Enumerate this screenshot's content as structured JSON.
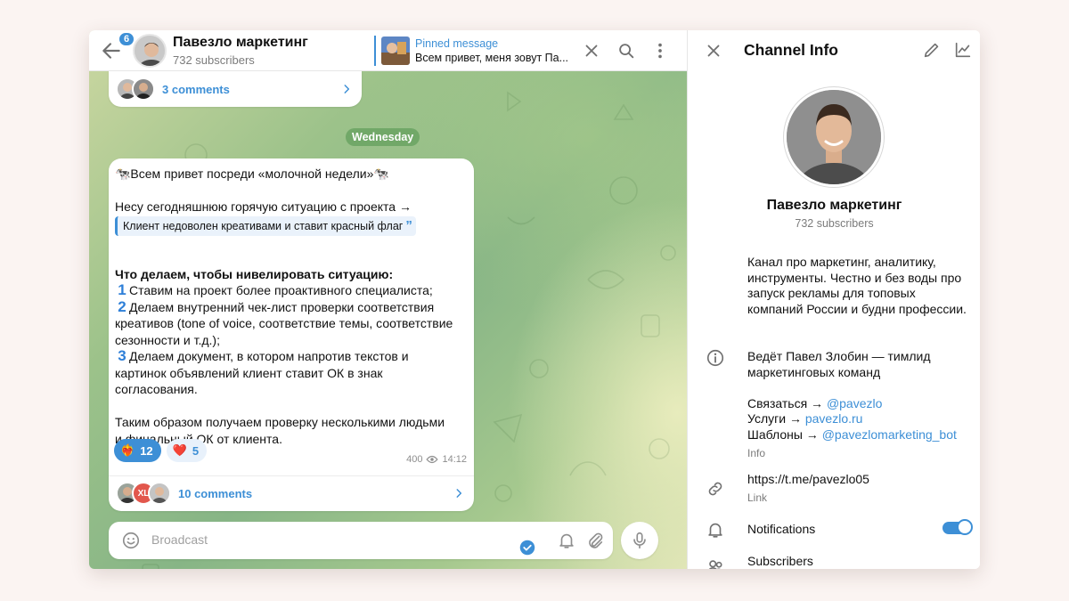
{
  "chat": {
    "unread_count": "6",
    "channel_title": "Павезло маркетинг",
    "subscribers": "732 subscribers",
    "pinned_label": "Pinned message",
    "pinned_text": "Всем привет, меня зовут Па...",
    "prev_comments": "3 comments",
    "date_pill": "Wednesday",
    "message": {
      "line1": "🐄Всем привет посреди «молочной недели»🐄",
      "line2": "Несу сегодняшнюю горячую ситуацию с проекта →",
      "quote": "Клиент недоволен креативами и ставит красный флаг",
      "heading": "Что делаем, чтобы нивелировать ситуацию:",
      "item1_num": "1",
      "item1": "Ставим на проект более проактивного специалиста;",
      "item2_num": "2",
      "item2_a": "Делаем внутренний чек-лист проверки соответствия",
      "item2_b": "креативов (tone of voice, соответствие темы, соответствие",
      "item2_c": "сезонности и т.д.);",
      "item3_num": "3",
      "item3_a": "Делаем документ, в котором напротив текстов и",
      "item3_b": "картинок объявлений клиент ставит ОК в знак",
      "item3_c": "согласования.",
      "closing_a": "Таким образом получаем проверку несколькими людьми",
      "closing_b": "и финальный ОК от клиента."
    },
    "reactions": [
      {
        "emoji": "❤️‍🔥",
        "count": "12",
        "active": true
      },
      {
        "emoji": "❤️",
        "count": "5",
        "active": false
      }
    ],
    "views": "400",
    "time": "14:12",
    "comments_avatar_initials": "XL",
    "comments": "10 comments",
    "composer_placeholder": "Broadcast"
  },
  "info": {
    "title": "Channel Info",
    "name": "Павезло маркетинг",
    "subscribers": "732 subscribers",
    "description": "Канал про маркетинг, аналитику, инструменты. Честно и без воды про запуск рекламы для топовых компаний России и будни профессии.",
    "led_by": "Ведёт Павел Злобин — тимлид маркетинговых команд",
    "contact_label": "Связаться → ",
    "contact_link": "@pavezlo",
    "services_label": "Услуги → ",
    "services_link": "pavezlo.ru",
    "templates_label": "Шаблоны → ",
    "templates_link": "@pavezlomarketing_bot",
    "info_caption": "Info",
    "link_value": "https://t.me/pavezlo05",
    "link_caption": "Link",
    "notifications": "Notifications",
    "notifications_on": true,
    "subscribers_item": "Subscribers"
  },
  "colors": {
    "accent": "#3d8fd6",
    "chat_background": "#8fbb88",
    "page_background": "#fbf4f2"
  },
  "icons": [
    "back-arrow-icon",
    "close-icon",
    "search-icon",
    "more-vert-icon",
    "chevron-right-icon",
    "eye-icon",
    "emoji-icon",
    "bell-icon",
    "attach-icon",
    "mic-icon",
    "edit-icon",
    "stats-icon",
    "info-icon",
    "link-icon",
    "people-icon"
  ]
}
